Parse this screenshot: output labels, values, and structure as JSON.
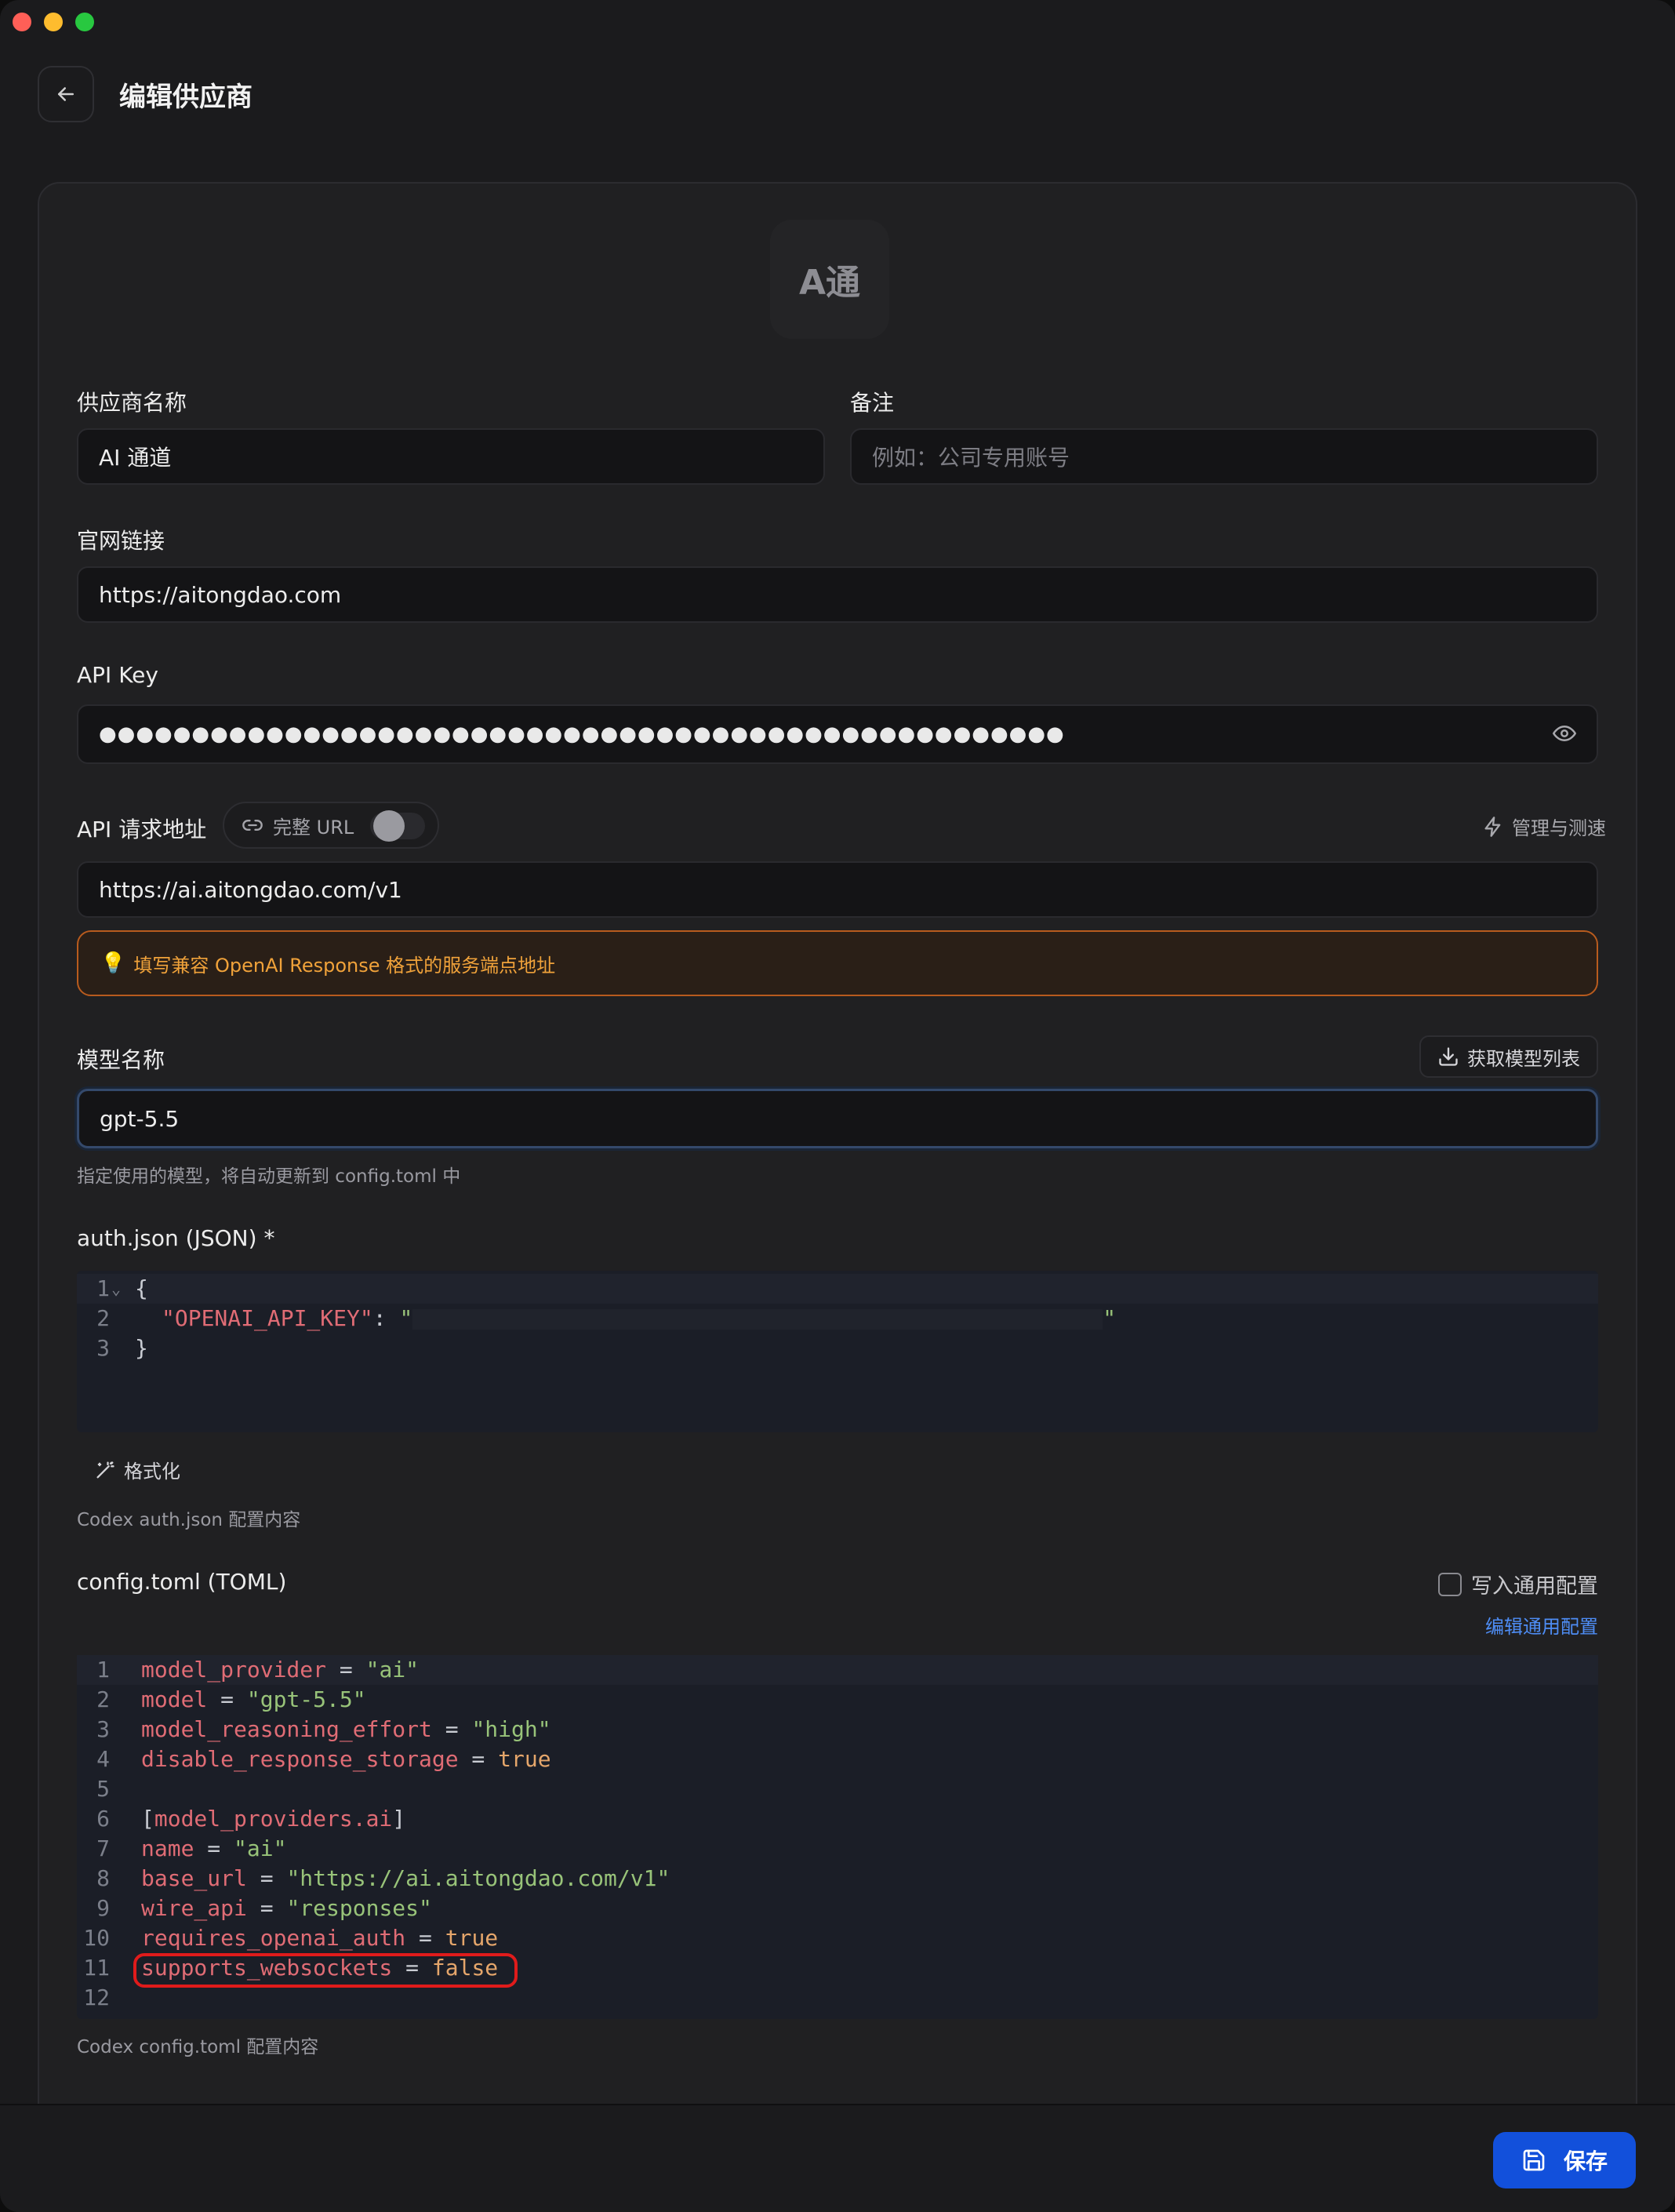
{
  "header": {
    "title": "编辑供应商"
  },
  "logo": {
    "text": "A通"
  },
  "fields": {
    "name": {
      "label": "供应商名称",
      "value": "AI 通道"
    },
    "note": {
      "label": "备注",
      "placeholder": "例如：公司专用账号"
    },
    "website": {
      "label": "官网链接",
      "value": "https://aitongdao.com"
    },
    "api_key": {
      "label": "API Key",
      "value": "●●●●●●●●●●●●●●●●●●●●●●●●●●●●●●●●●●●●●●●●●●●●●●●●●●●●"
    },
    "api_url": {
      "label": "API 请求地址",
      "full_url_label": "完整 URL",
      "full_url_enabled": false,
      "manage_label": "管理与测速",
      "value": "https://ai.aitongdao.com/v1",
      "hint": "填写兼容 OpenAI Response 格式的服务端点地址"
    },
    "model": {
      "label": "模型名称",
      "fetch_label": "获取模型列表",
      "value": "gpt-5.5",
      "help": "指定使用的模型，将自动更新到 config.toml 中"
    }
  },
  "auth_json": {
    "label": "auth.json (JSON) *",
    "line_numbers": [
      "1",
      "2",
      "3"
    ],
    "lines": [
      {
        "plain": "{"
      },
      {
        "key": "\"OPENAI_API_KEY\"",
        "sep": ": ",
        "open_quote": "\"",
        "close_quote": "\""
      },
      {
        "plain": "}"
      }
    ],
    "format_label": "格式化",
    "help": "Codex auth.json 配置内容"
  },
  "config_toml": {
    "label": "config.toml (TOML)",
    "write_common_label": "写入通用配置",
    "write_common_checked": false,
    "edit_common_label": "编辑通用配置",
    "line_numbers": [
      "1",
      "2",
      "3",
      "4",
      "5",
      "6",
      "7",
      "8",
      "9",
      "10",
      "11",
      "12"
    ],
    "lines": [
      {
        "key": "model_provider",
        "op": " = ",
        "val": "\"ai\""
      },
      {
        "key": "model",
        "op": " = ",
        "val": "\"gpt-5.5\""
      },
      {
        "key": "model_reasoning_effort",
        "op": " = ",
        "val": "\"high\""
      },
      {
        "key": "disable_response_storage",
        "op": " = ",
        "val": "true"
      },
      {
        "key": "",
        "op": "",
        "val": ""
      },
      {
        "key": "model_providers.ai",
        "op": "",
        "val": ""
      },
      {
        "key": "name",
        "op": " = ",
        "val": "\"ai\""
      },
      {
        "key": "base_url",
        "op": " = ",
        "val": "\"https://ai.aitongdao.com/v1\""
      },
      {
        "key": "wire_api",
        "op": " = ",
        "val": "\"responses\""
      },
      {
        "key": "requires_openai_auth",
        "op": " = ",
        "val": "true"
      },
      {
        "key": "supports_websockets",
        "op": " = ",
        "val": "false"
      },
      {
        "key": "",
        "op": "",
        "val": ""
      }
    ],
    "help": "Codex config.toml 配置内容"
  },
  "footer": {
    "save_label": "保存"
  },
  "colors": {
    "accent": "#1250db",
    "hint_border": "#b85b1e",
    "hint_text": "#f0a23a",
    "highlight": "#e01b1b"
  }
}
